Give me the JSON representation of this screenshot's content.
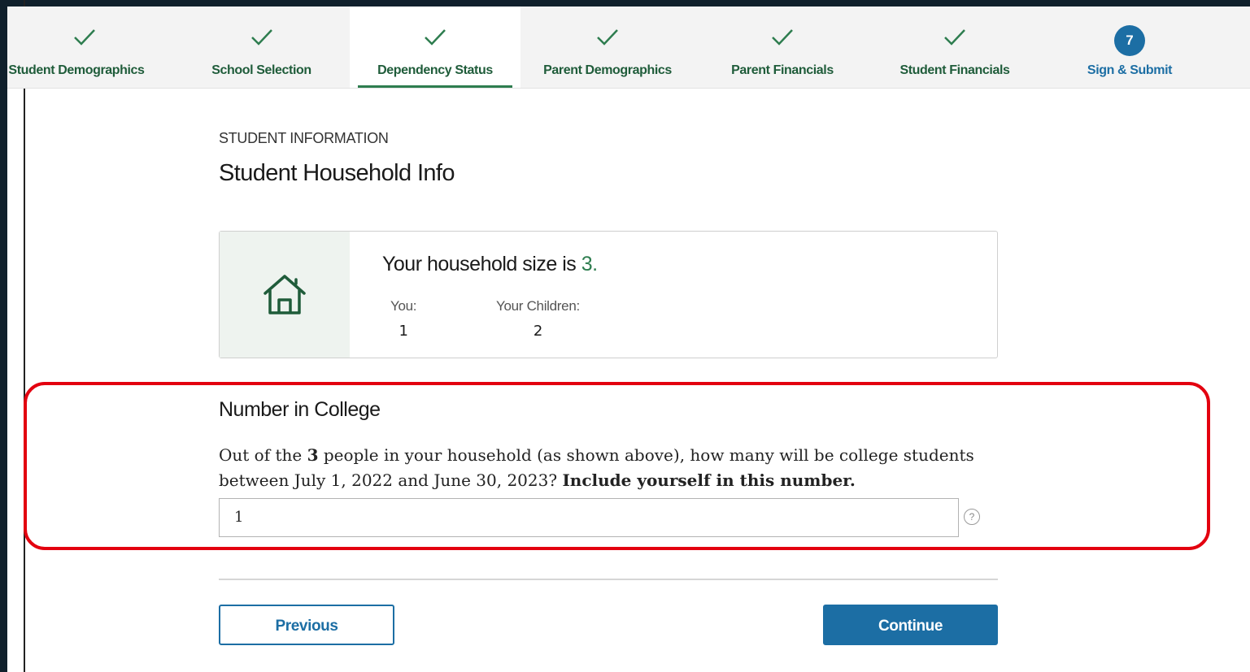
{
  "steps": [
    {
      "label": "Student Demographics",
      "state": "done",
      "icon": "check-icon"
    },
    {
      "label": "School Selection",
      "state": "done",
      "icon": "check-icon"
    },
    {
      "label": "Dependency Status",
      "state": "active",
      "icon": "check-icon"
    },
    {
      "label": "Parent Demographics",
      "state": "done",
      "icon": "check-icon"
    },
    {
      "label": "Parent Financials",
      "state": "done",
      "icon": "check-icon"
    },
    {
      "label": "Student Financials",
      "state": "done",
      "icon": "check-icon"
    },
    {
      "label": "Sign & Submit",
      "state": "current",
      "number": "7"
    }
  ],
  "page": {
    "eyebrow": "STUDENT INFORMATION",
    "title": "Student Household Info"
  },
  "household": {
    "icon": "house-icon",
    "heading_prefix": "Your household size is ",
    "size": "3.",
    "you_label": "You:",
    "you_value": "1",
    "children_label": "Your Children:",
    "children_value": "2"
  },
  "college": {
    "title": "Number in College",
    "question_part1": "Out of the ",
    "question_count": "3",
    "question_part2": " people in your household (as shown above), how many will be college students between July 1, 2022 and June 30, 2023? ",
    "question_bold": "Include yourself in this number.",
    "value": "1",
    "help_icon": "help-icon",
    "help_glyph": "?"
  },
  "buttons": {
    "previous": "Previous",
    "continue": "Continue"
  },
  "colors": {
    "green": "#2e7d4f",
    "blue": "#1c6ea4",
    "highlight": "#e3000f"
  }
}
